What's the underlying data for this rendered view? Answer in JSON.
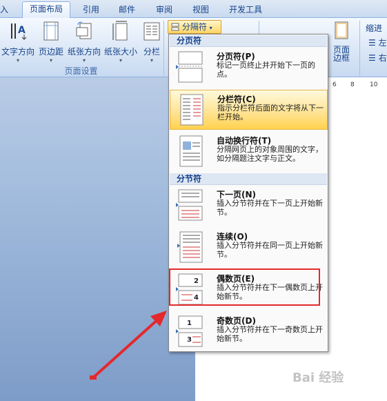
{
  "tabs": [
    "入",
    "页面布局",
    "引用",
    "邮件",
    "审阅",
    "视图",
    "开发工具"
  ],
  "ribbon": {
    "buttons": [
      "文字方向",
      "页边距",
      "纸张方向",
      "纸张大小",
      "分栏"
    ],
    "group_label": "页面设置",
    "breaks_label": "分隔符",
    "right_label_1": "页面",
    "right_label_2": "边框",
    "indent_label": "缩进",
    "indent_left": "左",
    "indent_right": "右"
  },
  "ruler_ticks": [
    "6",
    "8",
    "10"
  ],
  "menu": {
    "section1": "分页符",
    "section2": "分节符",
    "items": [
      {
        "title": "分页符(P)",
        "desc": "标记一页终止并开始下一页的点。"
      },
      {
        "title": "分栏符(C)",
        "desc": "指示分栏符后面的文字将从下一栏开始。"
      },
      {
        "title": "自动换行符(T)",
        "desc": "分隔网页上的对象周围的文字，如分隔题注文字与正文。"
      },
      {
        "title": "下一页(N)",
        "desc": "插入分节符并在下一页上开始新节。"
      },
      {
        "title": "连续(O)",
        "desc": "插入分节符并在同一页上开始新节。"
      },
      {
        "title": "偶数页(E)",
        "desc": "插入分节符并在下一偶数页上开始新节。"
      },
      {
        "title": "奇数页(D)",
        "desc": "插入分节符并在下一奇数页上开始新节。"
      }
    ]
  },
  "thumb_numbers": {
    "even_top": "2",
    "even_bottom": "4",
    "odd_top": "1",
    "odd_bottom": "3"
  },
  "watermark": "Bai 经验",
  "colors": {
    "highlight": "#ffd24d",
    "annotation": "#e4282c",
    "text": "#15428b"
  }
}
